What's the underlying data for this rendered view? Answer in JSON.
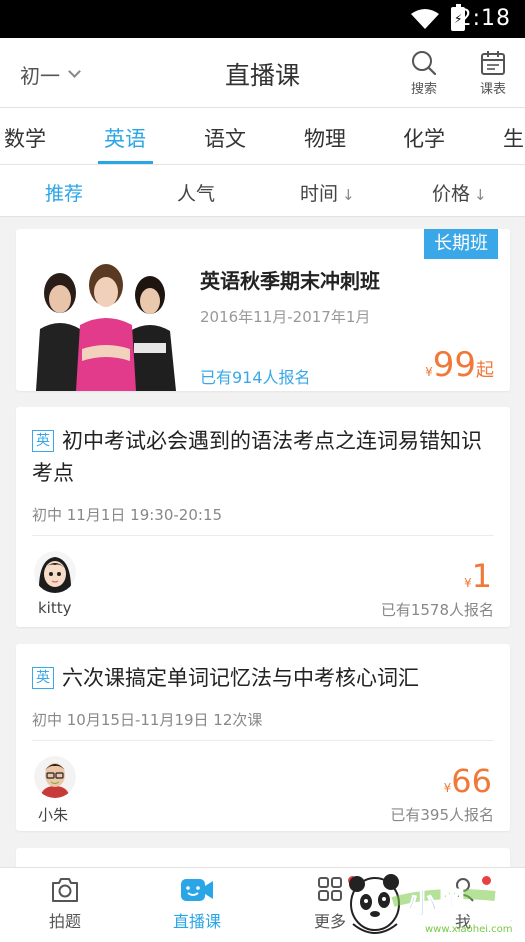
{
  "status_bar": {
    "time": "2:18"
  },
  "header": {
    "grade": "初一",
    "title": "直播课",
    "search_label": "搜索",
    "schedule_label": "课表"
  },
  "subjects": [
    "数学",
    "英语",
    "语文",
    "物理",
    "化学",
    "生"
  ],
  "active_subject": "英语",
  "sort": {
    "recommend": "推荐",
    "popular": "人气",
    "time": "时间",
    "price": "价格",
    "arrow": "↓"
  },
  "featured": {
    "badge": "长期班",
    "title": "英语秋季期末冲刺班",
    "date": "2016年11月-2017年1月",
    "enrolled": "已有914人报名",
    "currency": "¥",
    "price": "99",
    "price_suffix": "起"
  },
  "courses": [
    {
      "tag": "英",
      "title": "初中考试必会遇到的语法考点之连词易错知识考点",
      "meta": "初中  11月1日 19:30-20:15",
      "teacher": "kitty",
      "currency": "¥",
      "price": "1",
      "enrolled": "已有1578人报名"
    },
    {
      "tag": "英",
      "title": "六次课搞定单词记忆法与中考核心词汇",
      "meta": "初中  10月15日-11月19日 12次课",
      "teacher": "小朱",
      "currency": "¥",
      "price": "66",
      "enrolled": "已有395人报名"
    }
  ],
  "bottom_nav": {
    "shoot": "拍题",
    "live": "直播课",
    "more": "更多",
    "me": "我"
  },
  "watermark": {
    "text": "小黑游戏",
    "url": "www.xiaohei.com"
  },
  "colors": {
    "accent": "#2aa5e6",
    "price": "#f07838",
    "badge": "#3aa8e8"
  }
}
